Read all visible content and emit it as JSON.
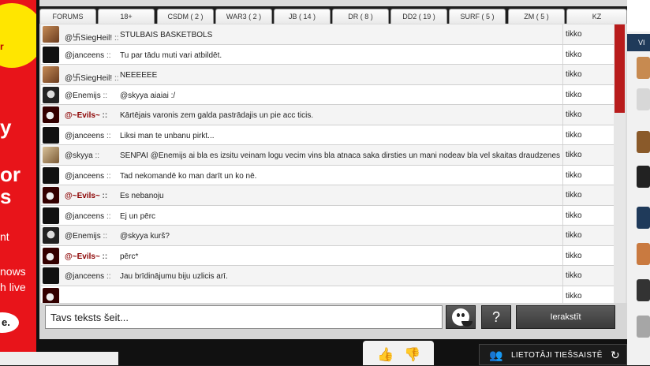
{
  "ad_left": {
    "line1": "r",
    "line2": "y",
    "line3": "or",
    "line4": "s",
    "line5": "nt",
    "line6": "nows",
    "line7": "h live",
    "oval": "e."
  },
  "tabs": [
    {
      "label": "FORUMS"
    },
    {
      "label": "18+"
    },
    {
      "label": "CSDM ( 2 )"
    },
    {
      "label": "WAR3 ( 2 )"
    },
    {
      "label": "JB ( 14 )"
    },
    {
      "label": "DR ( 8 )"
    },
    {
      "label": "DD2 ( 19 )"
    },
    {
      "label": "SURF ( 5 )"
    },
    {
      "label": "ZM ( 5 )"
    },
    {
      "label": "KZ"
    }
  ],
  "messages": [
    {
      "user": "@卐SiegHeil!",
      "sep": " ::",
      "text": "STULBAIS BASKETBOLS",
      "time": "tikko",
      "avatar": "photo",
      "evil": false
    },
    {
      "user": "@janceens",
      "sep": " ::",
      "text": "Tu par tādu muti vari atbildēt.",
      "time": "tikko",
      "avatar": "dark",
      "evil": false
    },
    {
      "user": "@卐SiegHeil!",
      "sep": " ::",
      "text": "NEEEEEE",
      "time": "tikko",
      "avatar": "photo",
      "evil": false
    },
    {
      "user": "@Enemijs",
      "sep": " ::",
      "text": "@skyya aiaiai :/",
      "time": "tikko",
      "avatar": "skull",
      "evil": false
    },
    {
      "user": "@~Evils~",
      "sep": " ::",
      "text": "Kārtējais varonis zem galda pastrādajis un pie acc ticis.",
      "time": "tikko",
      "avatar": "bunny",
      "evil": true
    },
    {
      "user": "@janceens",
      "sep": " ::",
      "text": "Liksi man te unbanu pirkt...",
      "time": "tikko",
      "avatar": "dark",
      "evil": false
    },
    {
      "user": "@skyya",
      "sep": " ::",
      "text": "SENPAI @Enemijs ai bla es izsitu veinam logu vecim vins bla atnaca saka dirsties un mani nodeav bla vel skaitas draudzenes",
      "time": "tikko",
      "avatar": "girl",
      "evil": false
    },
    {
      "user": "@janceens",
      "sep": " ::",
      "text": "Tad nekomandē ko man darīt un ko nē.",
      "time": "tikko",
      "avatar": "dark",
      "evil": false
    },
    {
      "user": "@~Evils~",
      "sep": " ::",
      "text": "Es nebanoju",
      "time": "tikko",
      "avatar": "bunny",
      "evil": true
    },
    {
      "user": "@janceens",
      "sep": " ::",
      "text": "Ej un pērc",
      "time": "tikko",
      "avatar": "dark",
      "evil": false
    },
    {
      "user": "@Enemijs",
      "sep": " ::",
      "text": "@skyya kurš?",
      "time": "tikko",
      "avatar": "skull",
      "evil": false
    },
    {
      "user": "@~Evils~",
      "sep": " ::",
      "text": "pērc*",
      "time": "tikko",
      "avatar": "bunny",
      "evil": true
    },
    {
      "user": "@janceens",
      "sep": " ::",
      "text": "Jau brīdinājumu biju uzlicis arī.",
      "time": "tikko",
      "avatar": "dark",
      "evil": false
    },
    {
      "user": "",
      "sep": "",
      "text": "",
      "time": "tikko",
      "avatar": "bunny",
      "evil": true
    }
  ],
  "input": {
    "placeholder": "Tavs teksts šeit..."
  },
  "buttons": {
    "help": "?",
    "submit": "Ierakstīt"
  },
  "bottom": {
    "online_label": "LIETOTĀJI TIEŠSAISTĒ"
  },
  "right_col": {
    "label": "VI"
  },
  "colors": {
    "accent_red": "#b81c1c",
    "ad_red": "#e8141a",
    "ad_yellow": "#ffe600"
  }
}
